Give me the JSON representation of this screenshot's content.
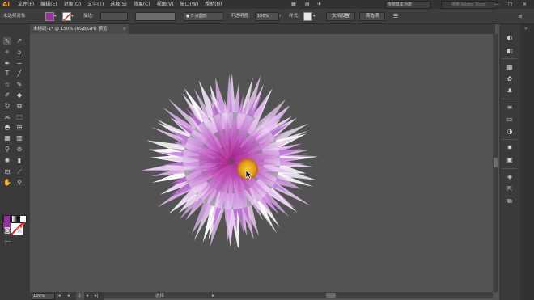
{
  "menubar": {
    "logo": "Ai",
    "menus": [
      "文件(F)",
      "编辑(E)",
      "对象(O)",
      "文字(T)",
      "选择(S)",
      "效果(C)",
      "视图(V)",
      "窗口(W)",
      "帮助(H)"
    ],
    "workspace": "传统基本功能",
    "search_placeholder": "搜索 Adobe Stock"
  },
  "control_bar": {
    "selection_status": "未选择对象",
    "stroke_label": "描边:",
    "brush_value": "5 点圆形",
    "opacity_label": "不透明度:",
    "opacity_value": "100%",
    "style_label": "样式:",
    "document_setup_button": "文档设置",
    "preferences_button": "首选项"
  },
  "document_tab": {
    "title": "未标题-1* @ 150% (RGB/GPU 预览)",
    "close": "×"
  },
  "status_bar": {
    "zoom": "150%",
    "artboard_number": "1",
    "tool_label": "选择"
  },
  "colors": {
    "fill": "#9b2fa0",
    "stroke": "#ffffff",
    "flower_center": "#e6a21f",
    "petal_primary": "#c98ad6"
  },
  "icons": {
    "tools": [
      "selection-arrow",
      "direct-selection-arrow",
      "magic-wand",
      "lasso",
      "pen",
      "curvature",
      "type",
      "line-segment",
      "rectangle",
      "paintbrush",
      "shaper",
      "eraser",
      "rotate",
      "scale",
      "width",
      "free-transform",
      "shape-builder",
      "perspective-grid",
      "mesh",
      "gradient",
      "eyedropper",
      "blend",
      "symbol-sprayer",
      "column-graph",
      "artboard",
      "slice",
      "hand",
      "zoom"
    ],
    "right_panel": [
      "color",
      "color-guide",
      "swatches",
      "brushes",
      "symbols",
      "graphic-styles",
      "stroke",
      "gradient",
      "transparency",
      "appearance",
      "layers",
      "asset-export",
      "artboards"
    ]
  }
}
